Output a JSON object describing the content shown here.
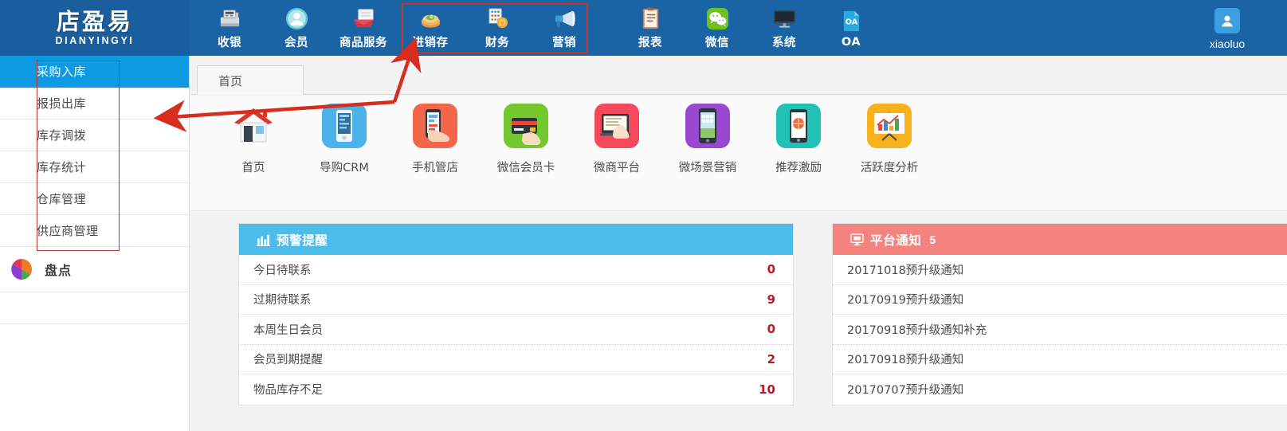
{
  "brand": {
    "cn": "店盈易",
    "en": "DIANYINGYI"
  },
  "topnav": {
    "items": [
      {
        "label": "收银",
        "icon": "cash-register-icon"
      },
      {
        "label": "会员",
        "icon": "member-avatar-icon"
      },
      {
        "label": "商品服务",
        "icon": "goods-service-icon"
      },
      {
        "label": "进销存",
        "icon": "inventory-icon"
      },
      {
        "label": "财务",
        "icon": "finance-icon"
      },
      {
        "label": "营销",
        "icon": "marketing-megaphone-icon"
      },
      {
        "label": "报表",
        "icon": "report-clipboard-icon"
      },
      {
        "label": "微信",
        "icon": "wechat-icon"
      },
      {
        "label": "系统",
        "icon": "system-monitor-icon"
      },
      {
        "label": "OA",
        "icon": "oa-icon"
      }
    ]
  },
  "user": {
    "name": "xiaoluo",
    "icon": "user-avatar-icon"
  },
  "sidebar": {
    "items": [
      {
        "label": "采购入库",
        "active": true
      },
      {
        "label": "报损出库",
        "active": false
      },
      {
        "label": "库存调拨",
        "active": false
      },
      {
        "label": "库存统计",
        "active": false
      },
      {
        "label": "仓库管理",
        "active": false
      },
      {
        "label": "供应商管理",
        "active": false
      }
    ],
    "group": {
      "label": "盘点",
      "icon": "pie-chart-icon"
    }
  },
  "tabs": [
    {
      "label": "首页",
      "active": true
    }
  ],
  "apps": [
    {
      "label": "首页",
      "icon": "home-house-icon",
      "color": "#d83a2c"
    },
    {
      "label": "导购CRM",
      "icon": "crm-phone-icon",
      "color": "#4ab3ea"
    },
    {
      "label": "手机管店",
      "icon": "mobile-shop-icon",
      "color": "#f4664a"
    },
    {
      "label": "微信会员卡",
      "icon": "membership-card-icon",
      "color": "#72c82d"
    },
    {
      "label": "微商平台",
      "icon": "wechat-business-icon",
      "color": "#f4485c"
    },
    {
      "label": "微场景营销",
      "icon": "scene-marketing-icon",
      "color": "#9a48cf"
    },
    {
      "label": "推荐激励",
      "icon": "referral-reward-icon",
      "color": "#1fc2b4"
    },
    {
      "label": "活跃度分析",
      "icon": "activity-analysis-icon",
      "color": "#f7b21b"
    }
  ],
  "warning_card": {
    "title": "预警提醒",
    "icon": "alert-chart-icon",
    "accent": "#4cbceb",
    "rows": [
      {
        "label": "今日待联系",
        "value": "0"
      },
      {
        "label": "过期待联系",
        "value": "9"
      },
      {
        "label": "本周生日会员",
        "value": "0"
      },
      {
        "label": "会员到期提醒",
        "value": "2"
      },
      {
        "label": "物品库存不足",
        "value": "10"
      }
    ]
  },
  "notice_card": {
    "title": "平台通知",
    "count": "5",
    "icon": "monitor-notice-icon",
    "accent": "#f4827f",
    "rows": [
      {
        "label": "20171018预升级通知"
      },
      {
        "label": "20170919预升级通知"
      },
      {
        "label": "20170918预升级通知补充"
      },
      {
        "label": "20170918预升级通知"
      },
      {
        "label": "20170707预升级通知"
      }
    ]
  },
  "annotations": {
    "color": "#c0392b"
  }
}
